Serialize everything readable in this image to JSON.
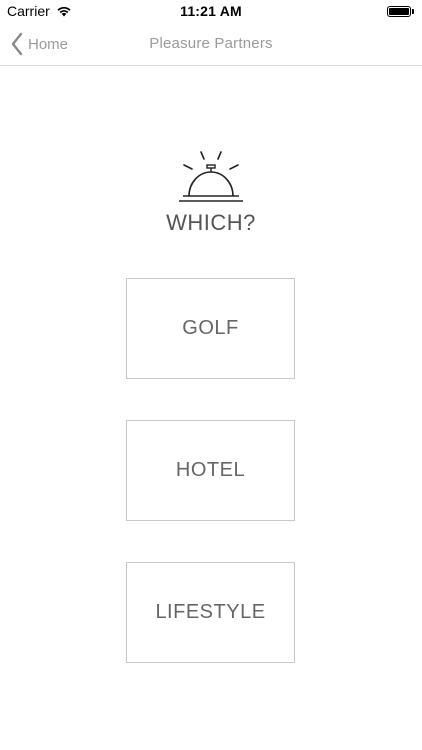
{
  "status_bar": {
    "carrier": "Carrier",
    "time": "11:21 AM",
    "battery_level": 1.0
  },
  "nav": {
    "back_label": "Home",
    "title": "Pleasure Partners"
  },
  "main": {
    "icon": "service-bell-icon",
    "heading": "WHICH?",
    "options": [
      {
        "label": "GOLF"
      },
      {
        "label": "HOTEL"
      },
      {
        "label": "LIFESTYLE"
      }
    ]
  },
  "colors": {
    "background": "#ffffff",
    "text": "#555555",
    "border": "#c9c9c9"
  }
}
